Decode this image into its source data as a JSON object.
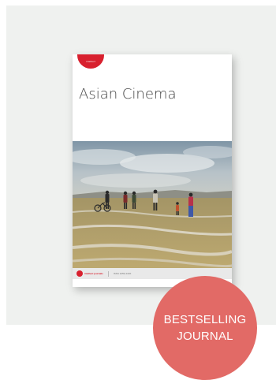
{
  "product": {
    "title": "Asian Cinema",
    "cover_tab_text": "intellect",
    "publisher": "intellect journals",
    "issn_text": "ISSN 1059-440X"
  },
  "badge": {
    "line1": "BESTSELLING",
    "line2": "JOURNAL"
  },
  "colors": {
    "card_background": "#eff1ef",
    "badge": "#e26a66",
    "publisher_red": "#d8202e"
  }
}
